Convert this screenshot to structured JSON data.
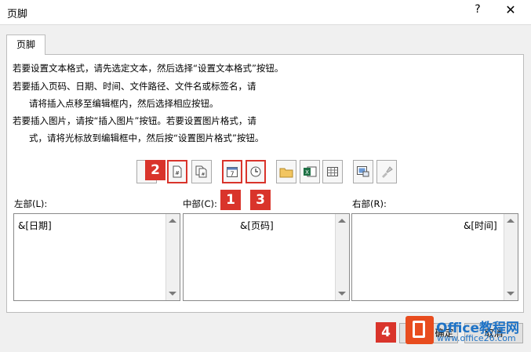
{
  "window": {
    "title": "页脚",
    "help": "?",
    "close": "✕"
  },
  "tab": {
    "label": "页脚"
  },
  "instructions": [
    "若要设置文本格式，请先选定文本，然后选择“设置文本格式”按钮。",
    "若要插入页码、日期、时间、文件路径、文件名或标签名，请",
    "请将插入点移至编辑框内，然后选择相应按钮。",
    "若要插入图片，请按“插入图片”按钮。若要设置图片格式，请",
    "式，请将光标放到编辑框中，然后按“设置图片格式”按钮。"
  ],
  "toolbar": {
    "buttons": [
      {
        "icon": "format-text-icon"
      },
      {
        "icon": "page-number-icon"
      },
      {
        "icon": "page-count-icon"
      },
      {
        "icon": "date-icon",
        "glyph": "7"
      },
      {
        "icon": "time-icon"
      },
      {
        "icon": "file-path-icon"
      },
      {
        "icon": "file-name-icon"
      },
      {
        "icon": "sheet-name-icon"
      },
      {
        "icon": "insert-picture-icon"
      },
      {
        "icon": "format-picture-icon"
      }
    ]
  },
  "badges": [
    "1",
    "2",
    "3",
    "4"
  ],
  "sections": {
    "left": {
      "label": "左部(L):",
      "value": "&[日期]"
    },
    "center": {
      "label": "中部(C):",
      "value": "&[页码]"
    },
    "right": {
      "label": "右部(R):",
      "value": "&[时间]"
    }
  },
  "buttons": {
    "ok": "确定",
    "cancel": "取消"
  },
  "watermark": {
    "brand": "Office教程网",
    "url": "www.office26.com"
  },
  "colors": {
    "highlight": "#d9342b",
    "brand": "#1f73c6",
    "logo": "#e84c1e"
  }
}
